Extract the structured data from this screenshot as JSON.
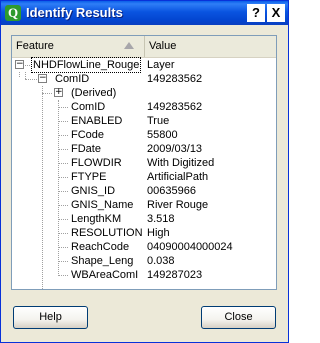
{
  "window": {
    "title": "Identify Results",
    "app_icon_glyph": "Q",
    "help_glyph": "?",
    "close_glyph": "X"
  },
  "tree": {
    "headers": {
      "feature": "Feature",
      "value": "Value"
    },
    "layer": {
      "label": "NHDFlowLine_Rouge",
      "value": "Layer"
    },
    "feature": {
      "label": "ComID",
      "value": "149283562"
    },
    "derived": {
      "label": "(Derived)"
    },
    "attributes": [
      {
        "name": "ComID",
        "value": "149283562"
      },
      {
        "name": "ENABLED",
        "value": "True"
      },
      {
        "name": "FCode",
        "value": "55800"
      },
      {
        "name": "FDate",
        "value": "2009/03/13"
      },
      {
        "name": "FLOWDIR",
        "value": "With Digitized"
      },
      {
        "name": "FTYPE",
        "value": "ArtificialPath"
      },
      {
        "name": "GNIS_ID",
        "value": "00635966"
      },
      {
        "name": "GNIS_Name",
        "value": "River Rouge"
      },
      {
        "name": "LengthKM",
        "value": "3.518"
      },
      {
        "name": "RESOLUTION",
        "value": "High"
      },
      {
        "name": "ReachCode",
        "value": "04090004000024"
      },
      {
        "name": "Shape_Leng",
        "value": "0.038"
      },
      {
        "name": "WBAreaComI",
        "value": "149287023"
      }
    ]
  },
  "buttons": {
    "help": "Help",
    "close": "Close"
  }
}
